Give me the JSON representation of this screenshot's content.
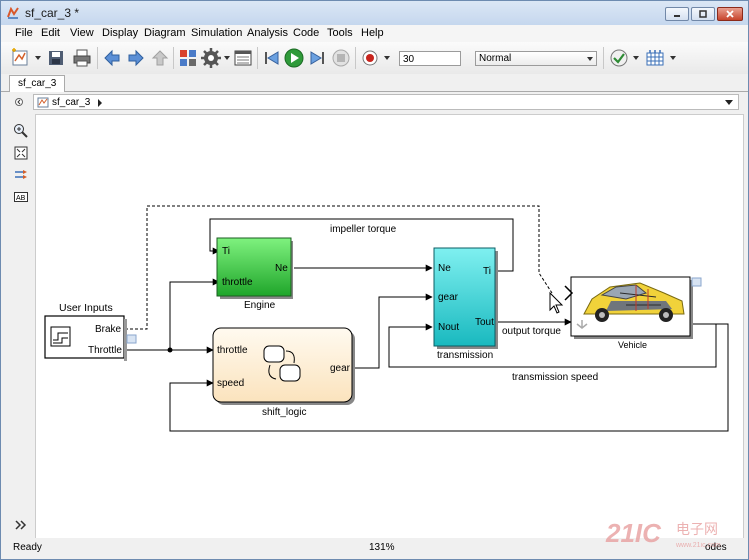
{
  "window": {
    "title": "sf_car_3 *"
  },
  "menu": [
    "File",
    "Edit",
    "View",
    "Display",
    "Diagram",
    "Simulation",
    "Analysis",
    "Code",
    "Tools",
    "Help"
  ],
  "toolbar": {
    "stop_time": "30",
    "sim_mode": "Normal"
  },
  "tab": {
    "label": "sf_car_3"
  },
  "breadcrumb": {
    "model": "sf_car_3"
  },
  "diagram": {
    "user_inputs": {
      "title": "User Inputs",
      "port_brake": "Brake",
      "port_throttle": "Throttle"
    },
    "engine": {
      "label": "Engine",
      "port_ti": "Ti",
      "port_throttle": "throttle",
      "port_ne": "Ne"
    },
    "shift_logic": {
      "label": "shift_logic",
      "port_throttle": "throttle",
      "port_speed": "speed",
      "port_gear": "gear"
    },
    "transmission": {
      "label": "transmission",
      "port_ne": "Ne",
      "port_gear": "gear",
      "port_nout": "Nout",
      "port_ti": "Ti",
      "port_tout": "Tout"
    },
    "vehicle": {
      "label": "Vehicle"
    },
    "signals": {
      "impeller_torque": "impeller torque",
      "output_torque": "output torque",
      "transmission_speed": "transmission speed"
    }
  },
  "status": {
    "left": "Ready",
    "zoom": "131%",
    "right": "odes"
  },
  "watermark": {
    "text": "21IC",
    "sub": "电子网",
    "url": "www.21ic.com"
  }
}
